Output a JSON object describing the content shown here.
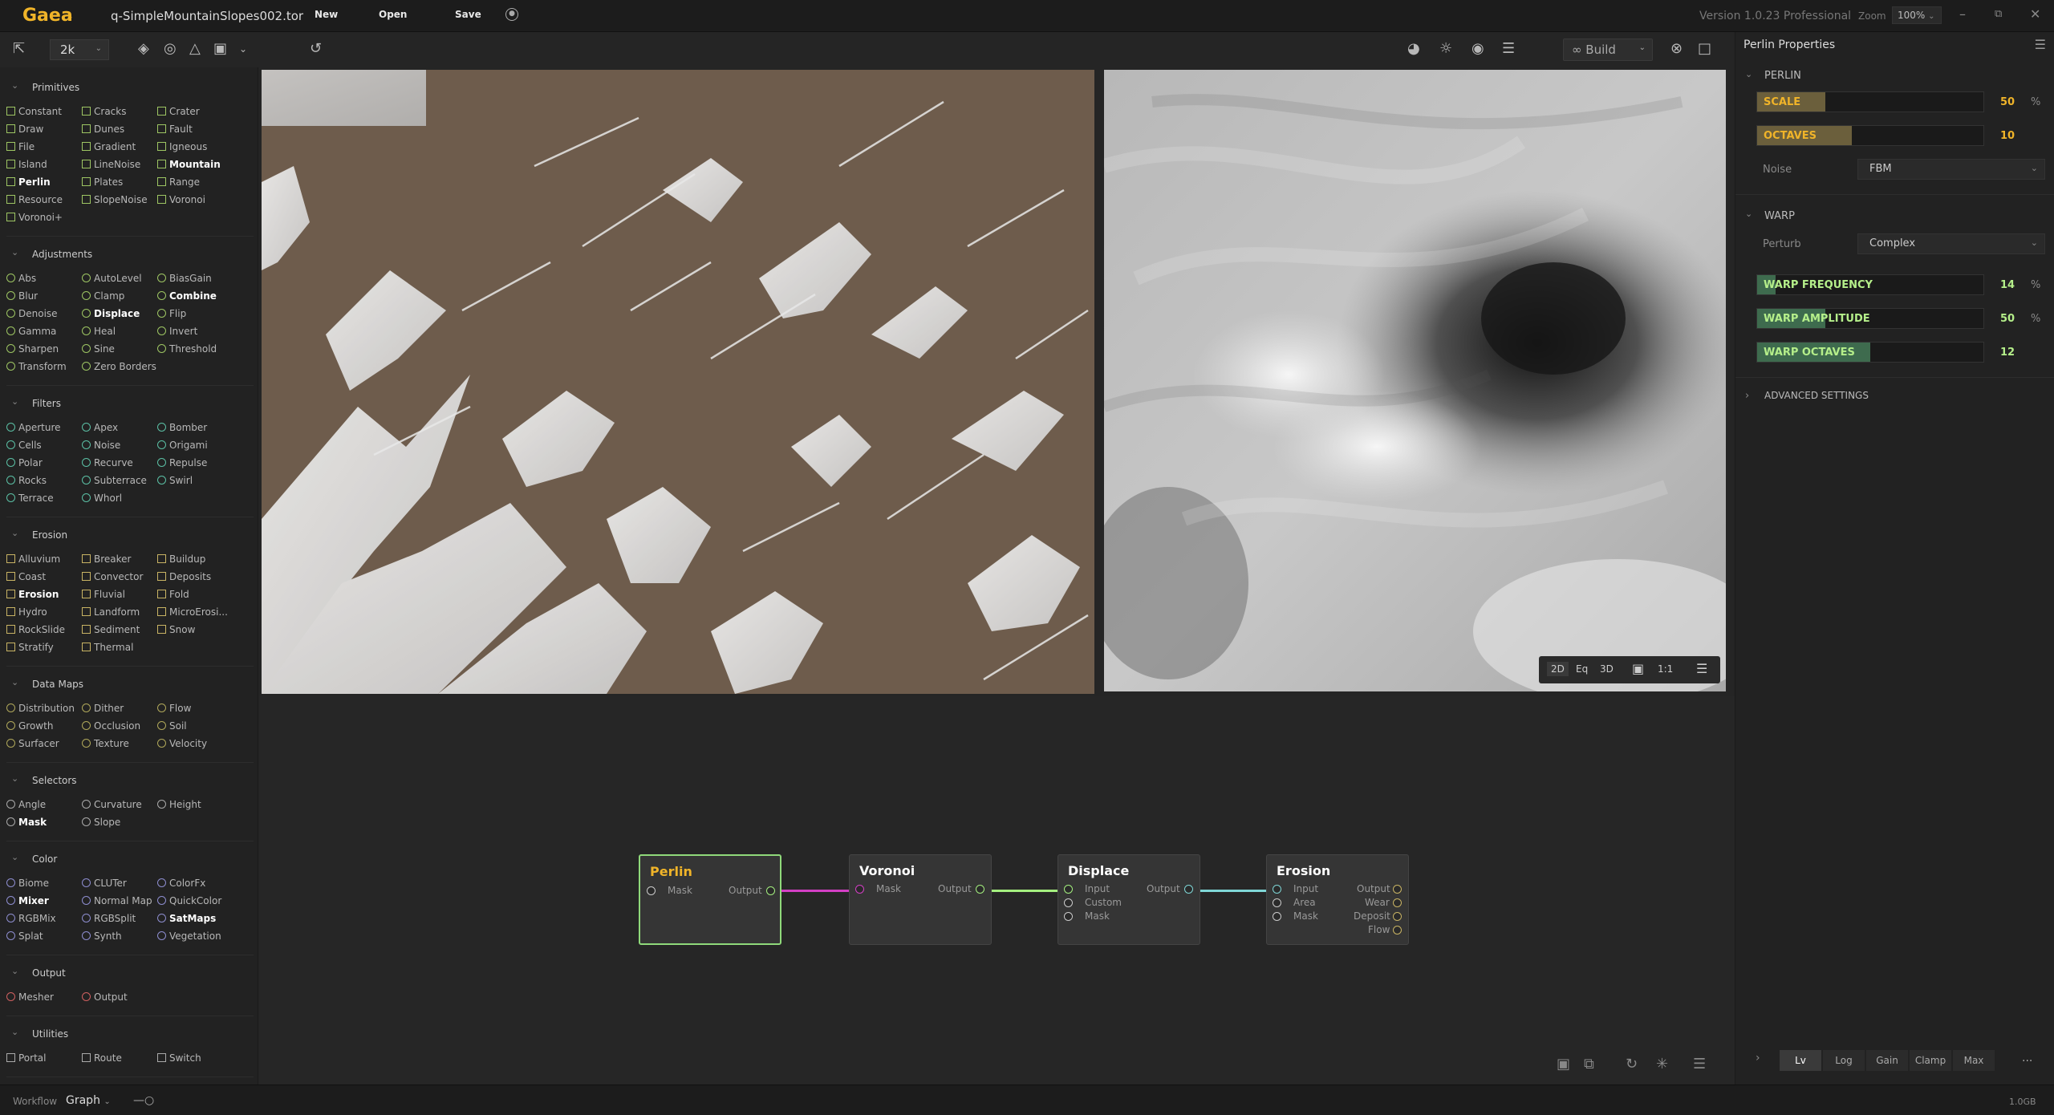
{
  "app": {
    "logo": "Gaea",
    "filename": "q-SimpleMountainSlopes002.tor",
    "menu": {
      "new": "New",
      "open": "Open",
      "save": "Save"
    },
    "version": "Version 1.0.23 Professional",
    "zoom_label": "Zoom",
    "zoom_value": "100%"
  },
  "toolbar": {
    "resolution": "2k",
    "build_label": "Build"
  },
  "sidebar": {
    "categories": [
      {
        "name": "Primitives",
        "icon_shape": "square",
        "items": [
          "Constant",
          "Cracks",
          "Crater",
          "Draw",
          "Dunes",
          "Fault",
          "File",
          "Gradient",
          "Igneous",
          "Island",
          "LineNoise",
          "Mountain",
          "Perlin",
          "Plates",
          "Range",
          "Resource",
          "SlopeNoise",
          "Voronoi",
          "Voronoi+"
        ],
        "bold": [
          "Mountain",
          "Perlin"
        ]
      },
      {
        "name": "Adjustments",
        "icon_shape": "circle",
        "items": [
          "Abs",
          "AutoLevel",
          "BiasGain",
          "Blur",
          "Clamp",
          "Combine",
          "Denoise",
          "Displace",
          "Flip",
          "Gamma",
          "Heal",
          "Invert",
          "Sharpen",
          "Sine",
          "Threshold",
          "Transform",
          "Zero Borders"
        ],
        "bold": [
          "Combine",
          "Displace"
        ]
      },
      {
        "name": "Filters",
        "icon_shape": "circle",
        "items": [
          "Aperture",
          "Apex",
          "Bomber",
          "Cells",
          "Noise",
          "Origami",
          "Polar",
          "Recurve",
          "Repulse",
          "Rocks",
          "Subterrace",
          "Swirl",
          "Terrace",
          "Whorl"
        ],
        "bold": []
      },
      {
        "name": "Erosion",
        "icon_shape": "square",
        "items": [
          "Alluvium",
          "Breaker",
          "Buildup",
          "Coast",
          "Convector",
          "Deposits",
          "Erosion",
          "Fluvial",
          "Fold",
          "Hydro",
          "Landform",
          "MicroErosi...",
          "RockSlide",
          "Sediment",
          "Snow",
          "Stratify",
          "Thermal"
        ],
        "bold": [
          "Erosion"
        ]
      },
      {
        "name": "Data Maps",
        "icon_shape": "circle",
        "items": [
          "Distribution",
          "Dither",
          "Flow",
          "Growth",
          "Occlusion",
          "Soil",
          "Surfacer",
          "Texture",
          "Velocity"
        ],
        "bold": []
      },
      {
        "name": "Selectors",
        "icon_shape": "circle",
        "items": [
          "Angle",
          "Curvature",
          "Height",
          "Mask",
          "Slope"
        ],
        "bold": [
          "Mask"
        ]
      },
      {
        "name": "Color",
        "icon_shape": "circle",
        "items": [
          "Biome",
          "CLUTer",
          "ColorFx",
          "Mixer",
          "Normal Map",
          "QuickColor",
          "RGBMix",
          "RGBSplit",
          "SatMaps",
          "Splat",
          "Synth",
          "Vegetation"
        ],
        "bold": [
          "Mixer",
          "SatMaps"
        ]
      },
      {
        "name": "Output",
        "icon_shape": "circle",
        "items": [
          "Mesher",
          "Output"
        ],
        "bold": []
      },
      {
        "name": "Utilities",
        "icon_shape": "square",
        "items": [
          "Portal",
          "Route",
          "Switch"
        ],
        "bold": []
      }
    ]
  },
  "viewport_controls": {
    "mode_2d": "2D",
    "mode_eq": "Eq",
    "mode_3d": "3D",
    "ratio": "1:1"
  },
  "graph": {
    "nodes": [
      {
        "title": "Perlin",
        "inputs": [
          "Mask"
        ],
        "outputs": [
          "Output"
        ],
        "selected": true
      },
      {
        "title": "Voronoi",
        "inputs": [
          "Mask"
        ],
        "outputs": [
          "Output"
        ],
        "selected": false
      },
      {
        "title": "Displace",
        "inputs": [
          "Input",
          "Custom",
          "Mask"
        ],
        "outputs": [
          "Output"
        ],
        "selected": false
      },
      {
        "title": "Erosion",
        "inputs": [
          "Input",
          "Area",
          "Mask"
        ],
        "outputs": [
          "Output",
          "Wear",
          "Deposit",
          "Flow"
        ],
        "selected": false
      }
    ]
  },
  "properties": {
    "title": "Perlin Properties",
    "perlin_section": "PERLIN",
    "scale": {
      "label": "SCALE",
      "value": "50",
      "unit": "%",
      "fraction": 0.3
    },
    "octaves": {
      "label": "OCTAVES",
      "value": "10",
      "fraction": 0.42
    },
    "noise_label": "Noise",
    "noise_value": "FBM",
    "warp_section": "WARP",
    "perturb_label": "Perturb",
    "perturb_value": "Complex",
    "warp_frequency": {
      "label": "WARP FREQUENCY",
      "value": "14",
      "unit": "%",
      "fraction": 0.08
    },
    "warp_amplitude": {
      "label": "WARP AMPLITUDE",
      "value": "50",
      "unit": "%",
      "fraction": 0.3
    },
    "warp_octaves": {
      "label": "WARP OCTAVES",
      "value": "12",
      "fraction": 0.5
    },
    "advanced": "ADVANCED SETTINGS",
    "bottom_tabs": [
      "Lv",
      "Log",
      "Gain",
      "Clamp",
      "Max"
    ],
    "more": "..."
  },
  "status": {
    "workflow": "Workflow",
    "graph": "Graph",
    "memory": "1.0GB"
  },
  "colors": {
    "accent": "#f0b429",
    "selected_node_border": "#8fd97a",
    "wire_pink": "#d33fc4",
    "wire_green": "#a4ef7f",
    "wire_teal": "#7fd6d6",
    "slider_scale": "#6b5f3c",
    "slider_warp": "#3e6b4e"
  }
}
